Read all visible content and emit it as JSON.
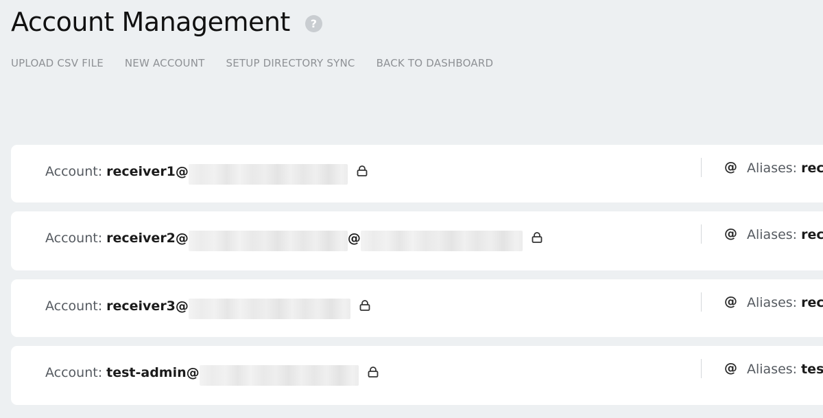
{
  "header": {
    "title": "Account Management",
    "help_icon": "?"
  },
  "toolbar": {
    "upload_csv": "UPLOAD CSV FILE",
    "new_account": "NEW ACCOUNT",
    "setup_sync": "SETUP DIRECTORY SYNC",
    "back_dashboard": "BACK TO DASHBOARD"
  },
  "labels": {
    "account": "Account:",
    "aliases": "Aliases:"
  },
  "accounts": [
    {
      "name": "receiver1@",
      "alias_preview": "rec"
    },
    {
      "name": "receiver2@",
      "second_at": "@",
      "alias_preview": "rec"
    },
    {
      "name": "receiver3@",
      "alias_preview": "rec"
    },
    {
      "name": "test-admin@",
      "alias_preview": "test"
    }
  ],
  "icons": {
    "lock": "lock-icon",
    "at": "at-icon",
    "help": "help-icon"
  },
  "colors": {
    "background": "#edf0f2",
    "card": "#ffffff",
    "toolbar_text": "#8e9195",
    "help_icon_bg": "#c9cdd1"
  }
}
